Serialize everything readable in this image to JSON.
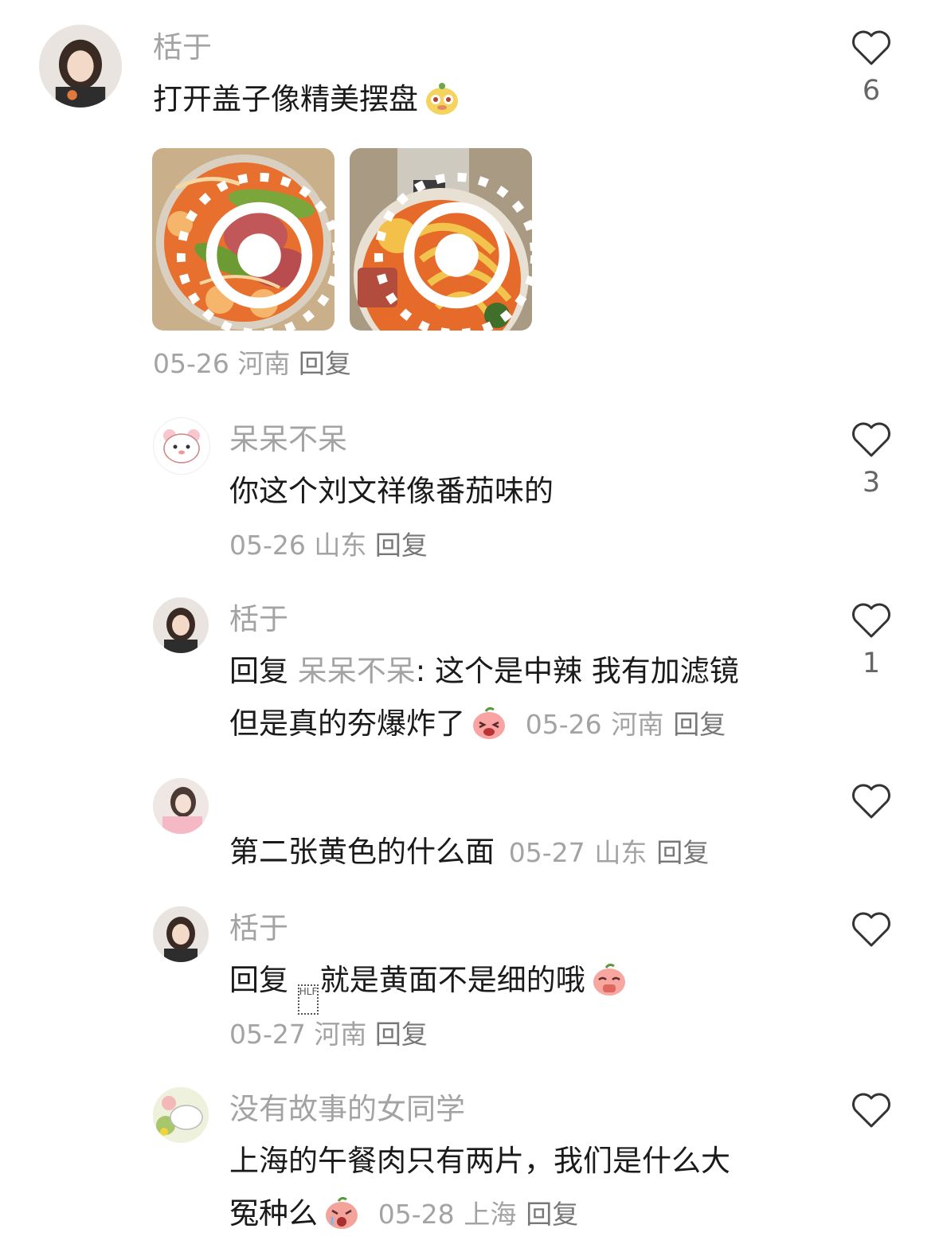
{
  "comments": [
    {
      "username": "栝于",
      "text": "打开盖子像精美摆盘",
      "emoji": "monkey-face-emoji",
      "date": "05-26",
      "location": "河南",
      "reply_label": "回复",
      "likes": "6",
      "photos": [
        "noodle-bowl-photo-1",
        "noodle-bowl-photo-2"
      ]
    },
    {
      "username": "呆呆不呆",
      "text": "你这个刘文祥像番茄味的",
      "date": "05-26",
      "location": "山东",
      "reply_label": "回复",
      "likes": "3"
    },
    {
      "username": "栝于",
      "reply_prefix": "回复",
      "reply_to": "呆呆不呆",
      "colon": ":",
      "text_line1": " 这个是中辣 我有加滤镜",
      "text_line2": "但是真的夯爆炸了",
      "emoji": "laughing-peach-emoji",
      "date": "05-26",
      "location": "河南",
      "reply_label": "回复",
      "likes": "1"
    },
    {
      "username": "",
      "text": "第二张黄色的什么面",
      "date": "05-27",
      "location": "山东",
      "reply_label": "回复",
      "likes": ""
    },
    {
      "username": "栝于",
      "reply_prefix": "回复",
      "glyph": "HLF",
      "text": "就是黄面不是细的哦",
      "emoji": "shy-peach-emoji",
      "date": "05-27",
      "location": "河南",
      "reply_label": "回复",
      "likes": ""
    },
    {
      "username": "没有故事的女同学",
      "text_line1": "上海的午餐肉只有两片，我们是什么大",
      "text_line2": "冤种么",
      "emoji": "crying-peach-emoji",
      "date": "05-28",
      "location": "上海",
      "reply_label": "回复",
      "likes": ""
    }
  ],
  "colors": {
    "muted": "#a3a3a3",
    "text": "#1a1a1a",
    "heart_stroke": "#333333"
  }
}
